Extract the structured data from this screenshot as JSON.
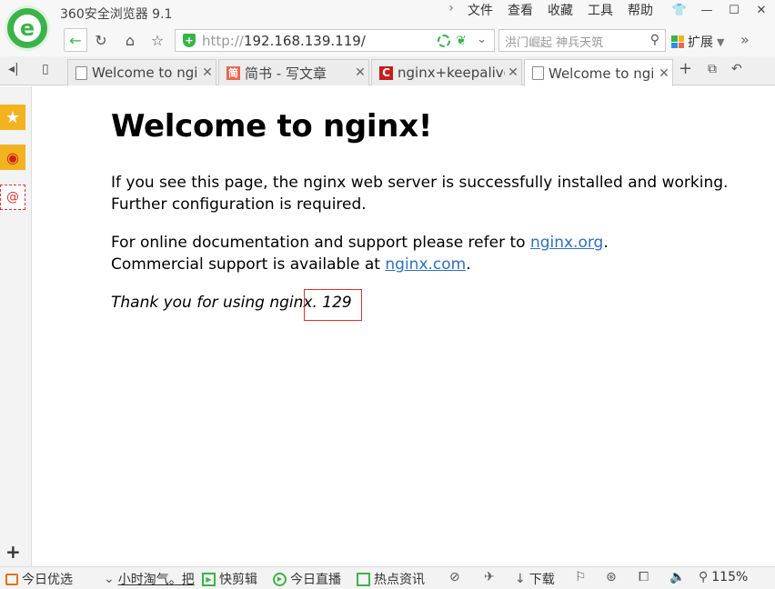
{
  "app": {
    "title": "360安全浏览器 9.1",
    "logo_letter": "e"
  },
  "menu": {
    "items": [
      "文件",
      "查看",
      "收藏",
      "工具",
      "帮助"
    ]
  },
  "address": {
    "url_prefix": "http://",
    "url_host": "192.168.139.119/"
  },
  "search": {
    "placeholder": "洪门崛起 神兵天筑"
  },
  "extensions": {
    "label": "扩展"
  },
  "tabs": [
    {
      "label": "Welcome to ngi",
      "icon": "page-icon",
      "active": false
    },
    {
      "label": "简书 - 写文章",
      "icon": "jianshu-icon",
      "badge": "简",
      "active": false
    },
    {
      "label": "nginx+keepalive",
      "icon": "csdn-icon",
      "badge": "C",
      "active": false
    },
    {
      "label": "Welcome to ngi",
      "icon": "page-icon",
      "active": true
    }
  ],
  "page": {
    "heading": "Welcome to nginx!",
    "p1_line1": "If you see this page, the nginx web server is successfully installed and working.",
    "p1_line2": "Further configuration is required.",
    "p2_line1_pre": "For online documentation and support please refer to ",
    "p2_link1": "nginx.org",
    "p2_line1_post": ".",
    "p2_line2_pre": "Commercial support is available at ",
    "p2_link2": "nginx.com",
    "p2_line2_post": ".",
    "p3_text": "Thank you for using nginx.",
    "p3_annotation": "129"
  },
  "status": {
    "items": [
      {
        "label": "今日优选",
        "icon": "gift-icon"
      },
      {
        "label": "小时淘气。把",
        "icon": "chevron-down-icon"
      },
      {
        "label": "快剪辑",
        "icon": "play-icon"
      },
      {
        "label": "今日直播",
        "icon": "live-icon"
      },
      {
        "label": "热点资讯",
        "icon": "news-icon"
      }
    ],
    "download_label": "下载",
    "zoom": "115%"
  },
  "colors": {
    "brand_green": "#3cb34a",
    "link": "#2f6fbf",
    "highlight_box": "#dd3333"
  }
}
